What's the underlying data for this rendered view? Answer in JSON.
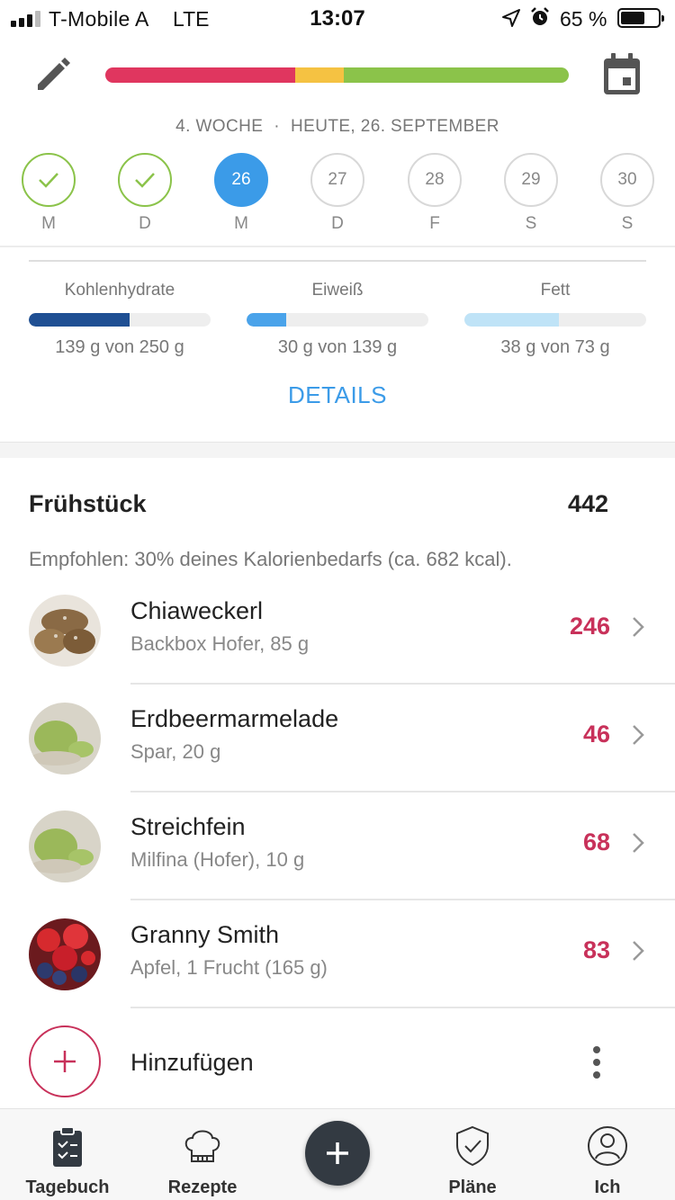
{
  "status_bar": {
    "carrier": "T-Mobile A",
    "network": "LTE",
    "time": "13:07",
    "battery_text": "65 %",
    "battery_level": 0.65,
    "signal_bars": 3
  },
  "header": {
    "progress_segments": [
      {
        "color": "#e0365f",
        "fraction": 0.41
      },
      {
        "color": "#f5c242",
        "fraction": 0.105
      },
      {
        "color": "#8bc34a",
        "fraction": 0.485
      }
    ],
    "week_label": "4. WOCHE",
    "separator": "·",
    "date_label": "HEUTE, 26. SEPTEMBER"
  },
  "days": [
    {
      "number": "",
      "letter": "M",
      "state": "done"
    },
    {
      "number": "",
      "letter": "D",
      "state": "done"
    },
    {
      "number": "26",
      "letter": "M",
      "state": "today"
    },
    {
      "number": "27",
      "letter": "D",
      "state": "future"
    },
    {
      "number": "28",
      "letter": "F",
      "state": "future"
    },
    {
      "number": "29",
      "letter": "S",
      "state": "future"
    },
    {
      "number": "30",
      "letter": "S",
      "state": "future"
    }
  ],
  "macros": [
    {
      "name": "Kohlenhydrate",
      "amount": "139 g von 250 g",
      "ratio": 0.556,
      "color": "#1f4f93"
    },
    {
      "name": "Eiweiß",
      "amount": "30 g von 139 g",
      "ratio": 0.216,
      "color": "#4aa3ea"
    },
    {
      "name": "Fett",
      "amount": "38 g von 73 g",
      "ratio": 0.52,
      "color": "#bfe3f7"
    }
  ],
  "details_label": "DETAILS",
  "meal": {
    "title": "Frühstück",
    "total": "442",
    "recommendation": "Empfohlen: 30% deines Kalorienbedarfs (ca. 682 kcal).",
    "items": [
      {
        "name": "Chiaweckerl",
        "desc": "Backbox Hofer, 85 g",
        "kcal": "246",
        "image": "bread-rolls"
      },
      {
        "name": "Erdbeermarmelade",
        "desc": "Spar, 20 g",
        "kcal": "46",
        "image": "green-spread"
      },
      {
        "name": "Streichfein",
        "desc": "Milfina (Hofer), 10 g",
        "kcal": "68",
        "image": "green-spread"
      },
      {
        "name": "Granny Smith",
        "desc": "Apfel, 1 Frucht (165 g)",
        "kcal": "83",
        "image": "berries"
      }
    ],
    "add_label": "Hinzufügen"
  },
  "tabs": [
    {
      "label": "Tagebuch",
      "icon": "diary-icon"
    },
    {
      "label": "Rezepte",
      "icon": "chef-hat-icon"
    },
    {
      "label": "",
      "icon": "plus-icon"
    },
    {
      "label": "Pläne",
      "icon": "shield-check-icon"
    },
    {
      "label": "Ich",
      "icon": "profile-icon"
    }
  ],
  "colors": {
    "accent_blue": "#3b9be8",
    "kcal_red": "#c8315a",
    "check_green": "#8bc34a"
  }
}
